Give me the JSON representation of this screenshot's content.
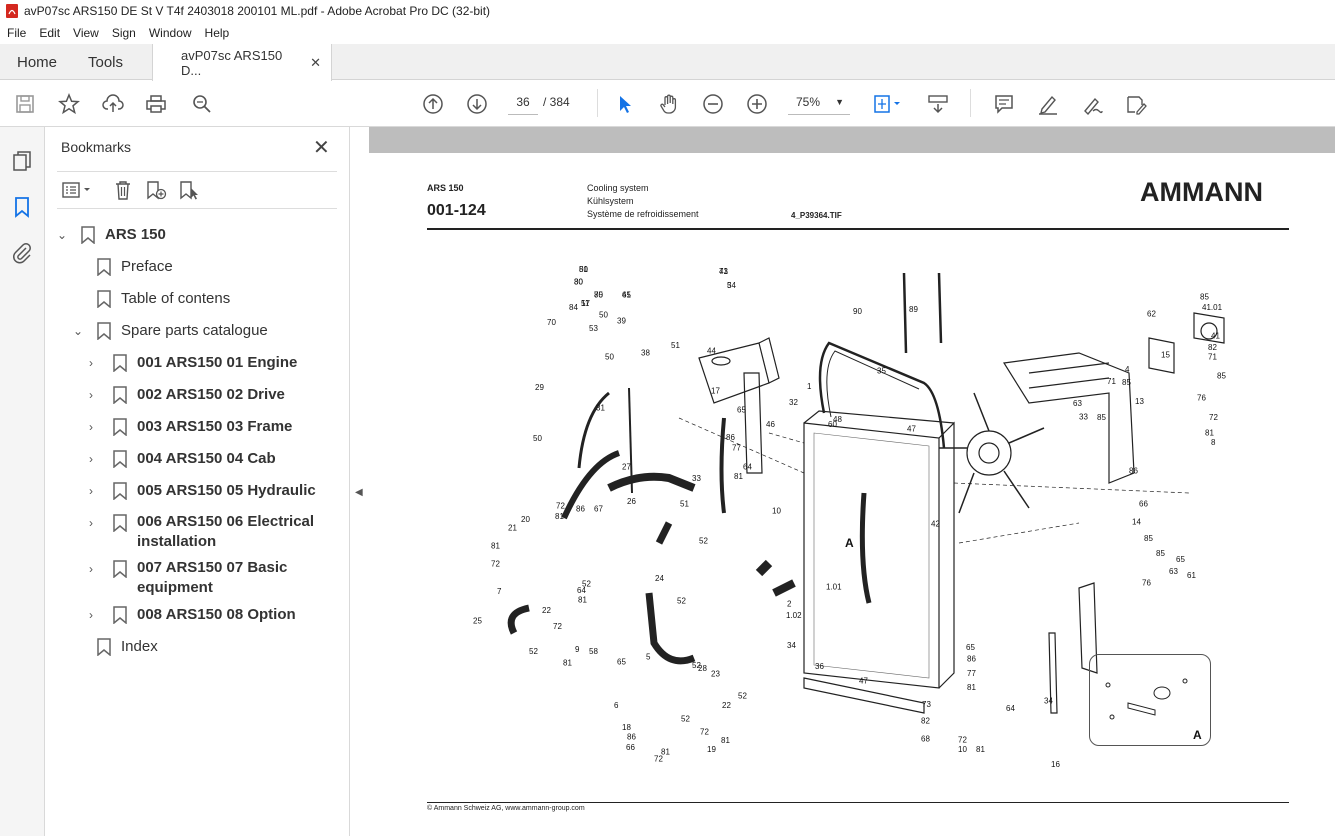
{
  "window": {
    "title": "avP07sc ARS150 DE St V T4f 2403018 200101 ML.pdf - Adobe Acrobat Pro DC (32-bit)"
  },
  "menu": [
    "File",
    "Edit",
    "View",
    "Sign",
    "Window",
    "Help"
  ],
  "tabs": {
    "home": "Home",
    "tools": "Tools",
    "doc": "avP07sc ARS150 D..."
  },
  "toolbar": {
    "page_current": "36",
    "page_total": "/ 384",
    "zoom": "75%"
  },
  "bookmarks": {
    "title": "Bookmarks",
    "items": [
      {
        "label": "ARS 150",
        "level": 0,
        "expanded": true
      },
      {
        "label": "Preface",
        "level": 1
      },
      {
        "label": "Table of contens",
        "level": 1
      },
      {
        "label": "Spare parts catalogue",
        "level": 1,
        "expanded": true
      },
      {
        "label": "001 ARS150 01 Engine",
        "level": 2
      },
      {
        "label": "002 ARS150 02 Drive",
        "level": 2
      },
      {
        "label": "003 ARS150 03 Frame",
        "level": 2
      },
      {
        "label": "004 ARS150 04 Cab",
        "level": 2
      },
      {
        "label": "005 ARS150 05 Hydraulic",
        "level": 2
      },
      {
        "label": "006 ARS150 06 Electrical installation",
        "level": 2
      },
      {
        "label": "007 ARS150 07 Basic equipment",
        "level": 2
      },
      {
        "label": "008 ARS150 08 Option",
        "level": 2
      },
      {
        "label": "Index",
        "level": 1
      }
    ]
  },
  "document": {
    "model": "ARS 150",
    "code": "001-124",
    "title_en": "Cooling system",
    "title_de": "Kühlsystem",
    "title_fr": "Système de refroidissement",
    "image_ref": "4_P39364.TIF",
    "brand": "AMMANN",
    "footer": "© Ammann Schweiz AG, www.ammann-group.com",
    "inset_label": "A",
    "detail_label": "A",
    "callouts": [
      "50",
      "43",
      "30",
      "3",
      "45",
      "75",
      "57",
      "84",
      "50",
      "39",
      "70",
      "53",
      "51",
      "44",
      "38",
      "50",
      "29",
      "31",
      "50",
      "17",
      "65",
      "27",
      "86",
      "77",
      "64",
      "81",
      "33",
      "46",
      "10",
      "26",
      "51",
      "52",
      "72",
      "86",
      "81",
      "67",
      "20",
      "21",
      "81",
      "72",
      "7",
      "52",
      "24",
      "64",
      "81",
      "52",
      "22",
      "72",
      "9",
      "58",
      "81",
      "65",
      "25",
      "52",
      "5",
      "52",
      "28",
      "52",
      "23",
      "6",
      "52",
      "22",
      "18",
      "86",
      "66",
      "81",
      "72",
      "72",
      "81",
      "19",
      "90",
      "89",
      "35",
      "32",
      "1",
      "60",
      "48",
      "47",
      "42",
      "1.01",
      "2",
      "1.02",
      "34",
      "36",
      "47",
      "73",
      "82",
      "68",
      "65",
      "86",
      "77",
      "81",
      "64",
      "10",
      "81",
      "72",
      "34",
      "16",
      "33",
      "4",
      "63",
      "85",
      "13",
      "71",
      "85",
      "15",
      "62",
      "85",
      "41.01",
      "41",
      "82",
      "71",
      "85",
      "76",
      "72",
      "81",
      "8",
      "86",
      "66",
      "14",
      "85",
      "63",
      "61",
      "85",
      "76",
      "65",
      "81",
      "71",
      "80",
      "54",
      "61",
      "80",
      "11"
    ]
  }
}
